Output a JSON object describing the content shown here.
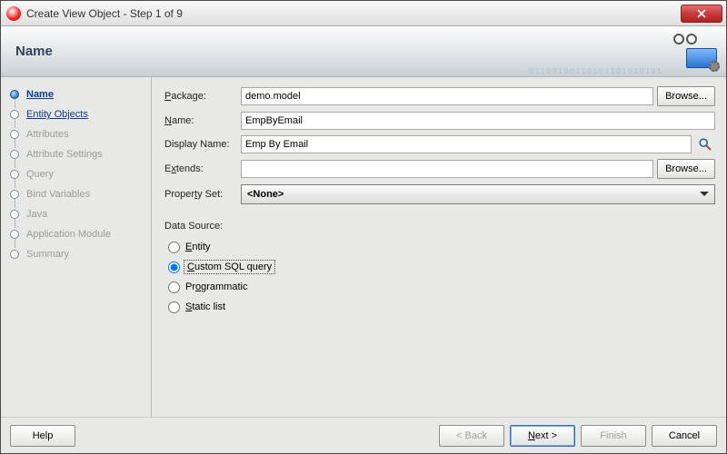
{
  "window": {
    "title": "Create View Object - Step 1 of 9"
  },
  "header": {
    "title": "Name",
    "bitstring": "01100100110101101010101"
  },
  "steps": [
    {
      "label": "Name",
      "state": "current"
    },
    {
      "label": "Entity Objects",
      "state": "link"
    },
    {
      "label": "Attributes",
      "state": "disabled"
    },
    {
      "label": "Attribute Settings",
      "state": "disabled"
    },
    {
      "label": "Query",
      "state": "disabled"
    },
    {
      "label": "Bind Variables",
      "state": "disabled"
    },
    {
      "label": "Java",
      "state": "disabled"
    },
    {
      "label": "Application Module",
      "state": "disabled"
    },
    {
      "label": "Summary",
      "state": "disabled"
    }
  ],
  "form": {
    "package": {
      "label": "Package:",
      "value": "demo.model",
      "browse": "Browse..."
    },
    "name": {
      "label": "Name:",
      "value": "EmpByEmail"
    },
    "displayName": {
      "label": "Display Name:",
      "value": "Emp By Email"
    },
    "extends": {
      "label": "Extends:",
      "value": "",
      "browse": "Browse..."
    },
    "propertySet": {
      "label": "Property Set:",
      "value": "<None>"
    },
    "dataSource": {
      "label": "Data Source:",
      "options": {
        "entity": "Entity",
        "customSql": "Custom SQL query",
        "programmatic": "Programmatic",
        "staticList": "Static list"
      },
      "selected": "customSql"
    }
  },
  "footer": {
    "help": "Help",
    "back": "< Back",
    "next": "Next >",
    "finish": "Finish",
    "cancel": "Cancel"
  }
}
